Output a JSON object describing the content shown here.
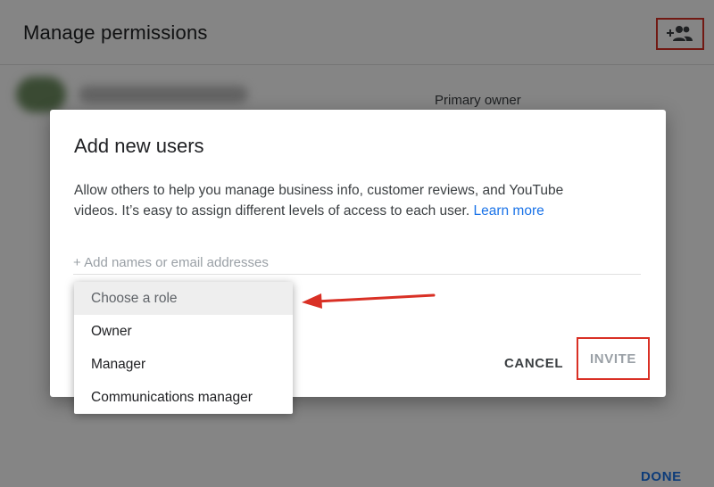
{
  "page": {
    "title": "Manage permissions",
    "owner_role": "Primary owner",
    "done_label": "DONE"
  },
  "icons": {
    "add_person": "person-add-icon"
  },
  "dialog": {
    "title": "Add new users",
    "description": "Allow others to help you manage business info, customer reviews, and YouTube videos. It’s easy to assign different levels of access to each user.",
    "learn_more": "Learn more",
    "input_placeholder": "+ Add names or email addresses",
    "cancel_label": "CANCEL",
    "invite_label": "INVITE"
  },
  "role_menu": {
    "header": "Choose a role",
    "options": [
      "Owner",
      "Manager",
      "Communications manager"
    ]
  },
  "colors": {
    "accent": "#1a73e8",
    "annotation": "#d93025",
    "scrim": "rgba(0,0,0,0.48)"
  }
}
